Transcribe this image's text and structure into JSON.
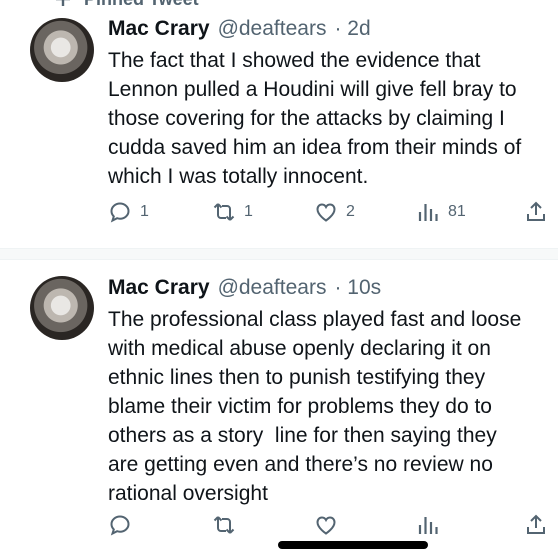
{
  "pinned": {
    "label": "Pinned Tweet",
    "icon": "pin-icon"
  },
  "tweets": [
    {
      "name": "Mac Crary",
      "handle": "@deaftears",
      "time": "· 2d",
      "lines": [
        "The fact that I showed the evidence that",
        "Lennon pulled a Houdini will give fell bray to",
        "those covering for the attacks by claiming I",
        "cudda saved him an idea from their minds of",
        "which I was totally innocent."
      ],
      "replies": "1",
      "retweets": "1",
      "likes": "2",
      "views": "81"
    },
    {
      "name": "Mac Crary",
      "handle": "@deaftears",
      "time": "· 10s",
      "lines": [
        "The professional class played fast and loose",
        "with medical abuse openly declaring it on",
        "ethnic lines then to punish testifying they",
        "blame their victim for problems they do to",
        "others as a story  line for then saying they",
        "are getting even and there’s no review no",
        "rational oversight"
      ],
      "replies": "",
      "retweets": "",
      "likes": "",
      "views": ""
    }
  ],
  "colors": {
    "text": "#0f1419",
    "secondary": "#536471",
    "divider": "#f7f9f9"
  }
}
